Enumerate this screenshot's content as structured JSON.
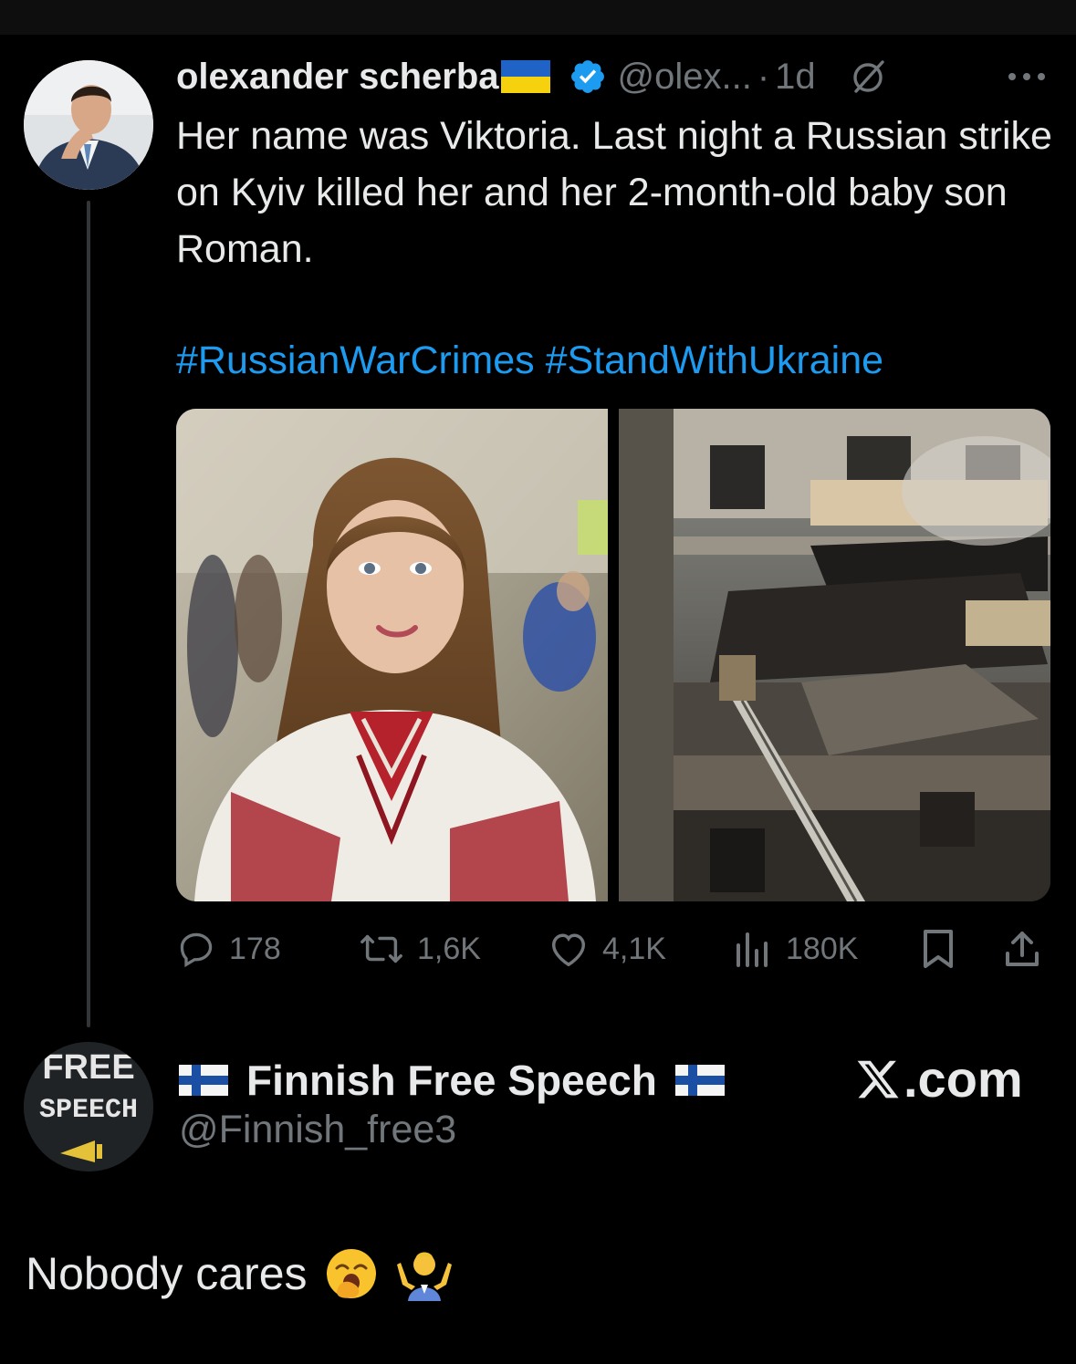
{
  "tweet": {
    "display_name": "olexander scherba",
    "handle": "@olex...",
    "separator": "·",
    "time": "1d",
    "text": "Her name was Viktoria. Last night a Russian strike on Kyiv killed her and her 2-month-old baby son Roman.",
    "hashtags": "#RussianWarCrimes #StandWithUkraine",
    "media": [
      "portrait-photo",
      "destroyed-building-photo"
    ],
    "actions": {
      "replies": "178",
      "reposts": "1,6K",
      "likes": "4,1K",
      "views": "180K"
    },
    "icons": [
      "grok-icon",
      "more-icon",
      "reply-icon",
      "repost-icon",
      "like-icon",
      "views-icon",
      "bookmark-icon",
      "share-icon"
    ]
  },
  "quote": {
    "display_name": "Finnish Free Speech",
    "handle": "@Finnish_free3",
    "avatar_text_top": "FREE",
    "avatar_text_bottom": "SPEECH",
    "watermark": ".com"
  },
  "reply": {
    "text": "Nobody cares"
  },
  "colors": {
    "background": "#000000",
    "text": "#e7e9ea",
    "muted": "#71767b",
    "link": "#1d9bf0",
    "verified": "#1d9bf0"
  }
}
